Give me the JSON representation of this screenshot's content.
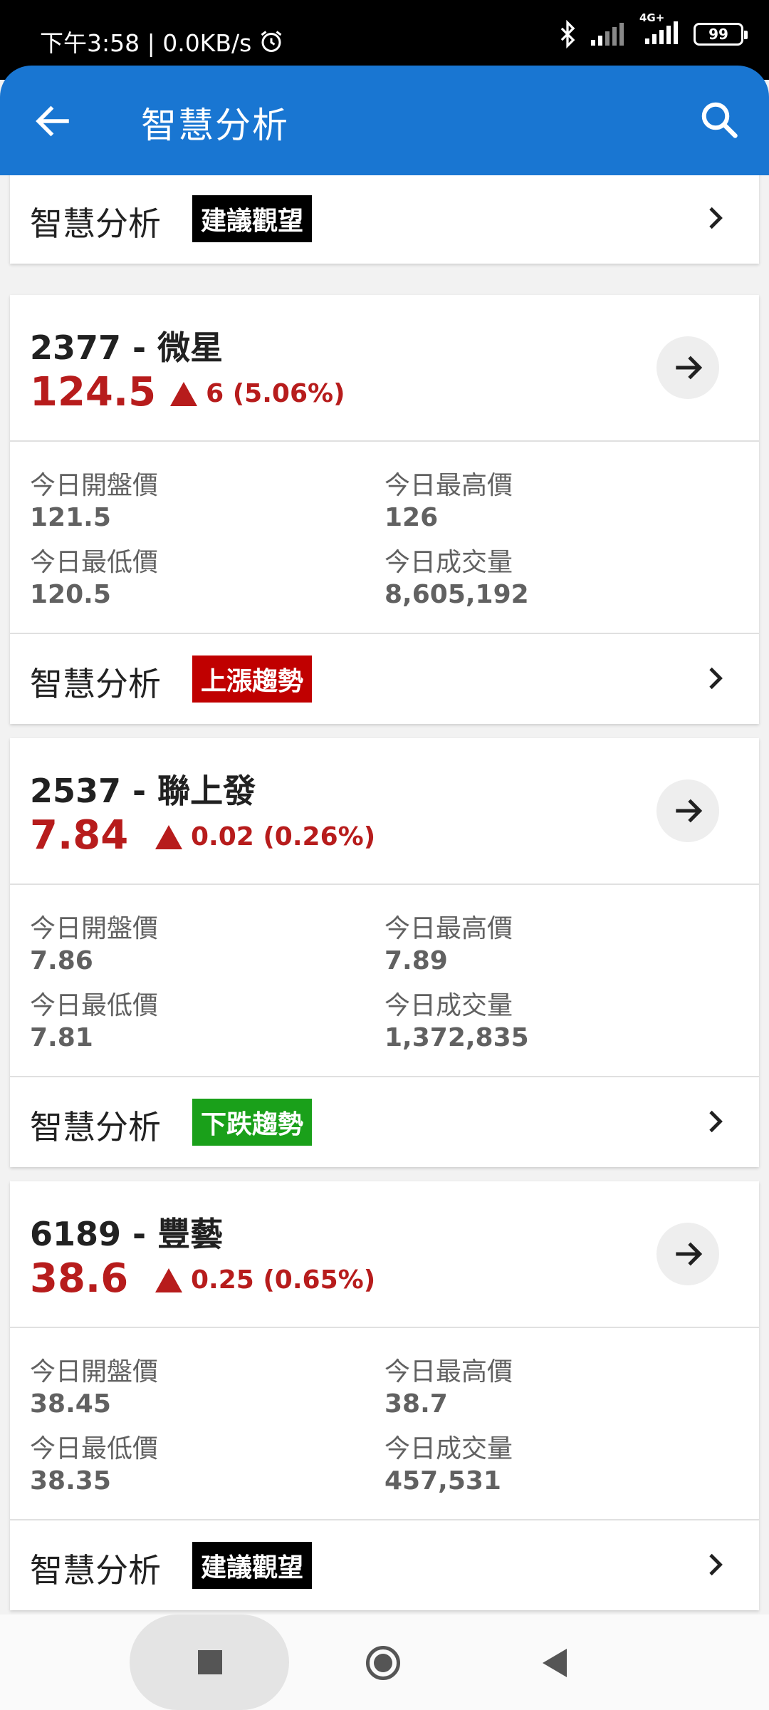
{
  "status_bar": {
    "time_speed": "下午3:58 | 0.0KB/s",
    "network": "4G+",
    "battery": "99"
  },
  "app_bar": {
    "title": "智慧分析"
  },
  "colors": {
    "primary": "#1976d2",
    "up": "#b71c1c",
    "badge_watch": "#000000",
    "badge_up": "#c00000",
    "badge_down": "#1aa01a"
  },
  "top_card": {
    "analysis_label": "智慧分析",
    "badge": "建議觀望"
  },
  "stocks": [
    {
      "name": "2377 - 微星",
      "price": "124.5",
      "change": "6 (5.06%)",
      "stats": {
        "open_label": "今日開盤價",
        "open": "121.5",
        "high_label": "今日最高價",
        "high": "126",
        "low_label": "今日最低價",
        "low": "120.5",
        "volume_label": "今日成交量",
        "volume": "8,605,192"
      },
      "analysis_label": "智慧分析",
      "badge": "上漲趨勢"
    },
    {
      "name": "2537 - 聯上發",
      "price": "7.84",
      "change": "0.02 (0.26%)",
      "stats": {
        "open_label": "今日開盤價",
        "open": "7.86",
        "high_label": "今日最高價",
        "high": "7.89",
        "low_label": "今日最低價",
        "low": "7.81",
        "volume_label": "今日成交量",
        "volume": "1,372,835"
      },
      "analysis_label": "智慧分析",
      "badge": "下跌趨勢"
    },
    {
      "name": "6189 - 豐藝",
      "price": "38.6",
      "change": "0.25 (0.65%)",
      "stats": {
        "open_label": "今日開盤價",
        "open": "38.45",
        "high_label": "今日最高價",
        "high": "38.7",
        "low_label": "今日最低價",
        "low": "38.35",
        "volume_label": "今日成交量",
        "volume": "457,531"
      },
      "analysis_label": "智慧分析",
      "badge": "建議觀望"
    }
  ]
}
